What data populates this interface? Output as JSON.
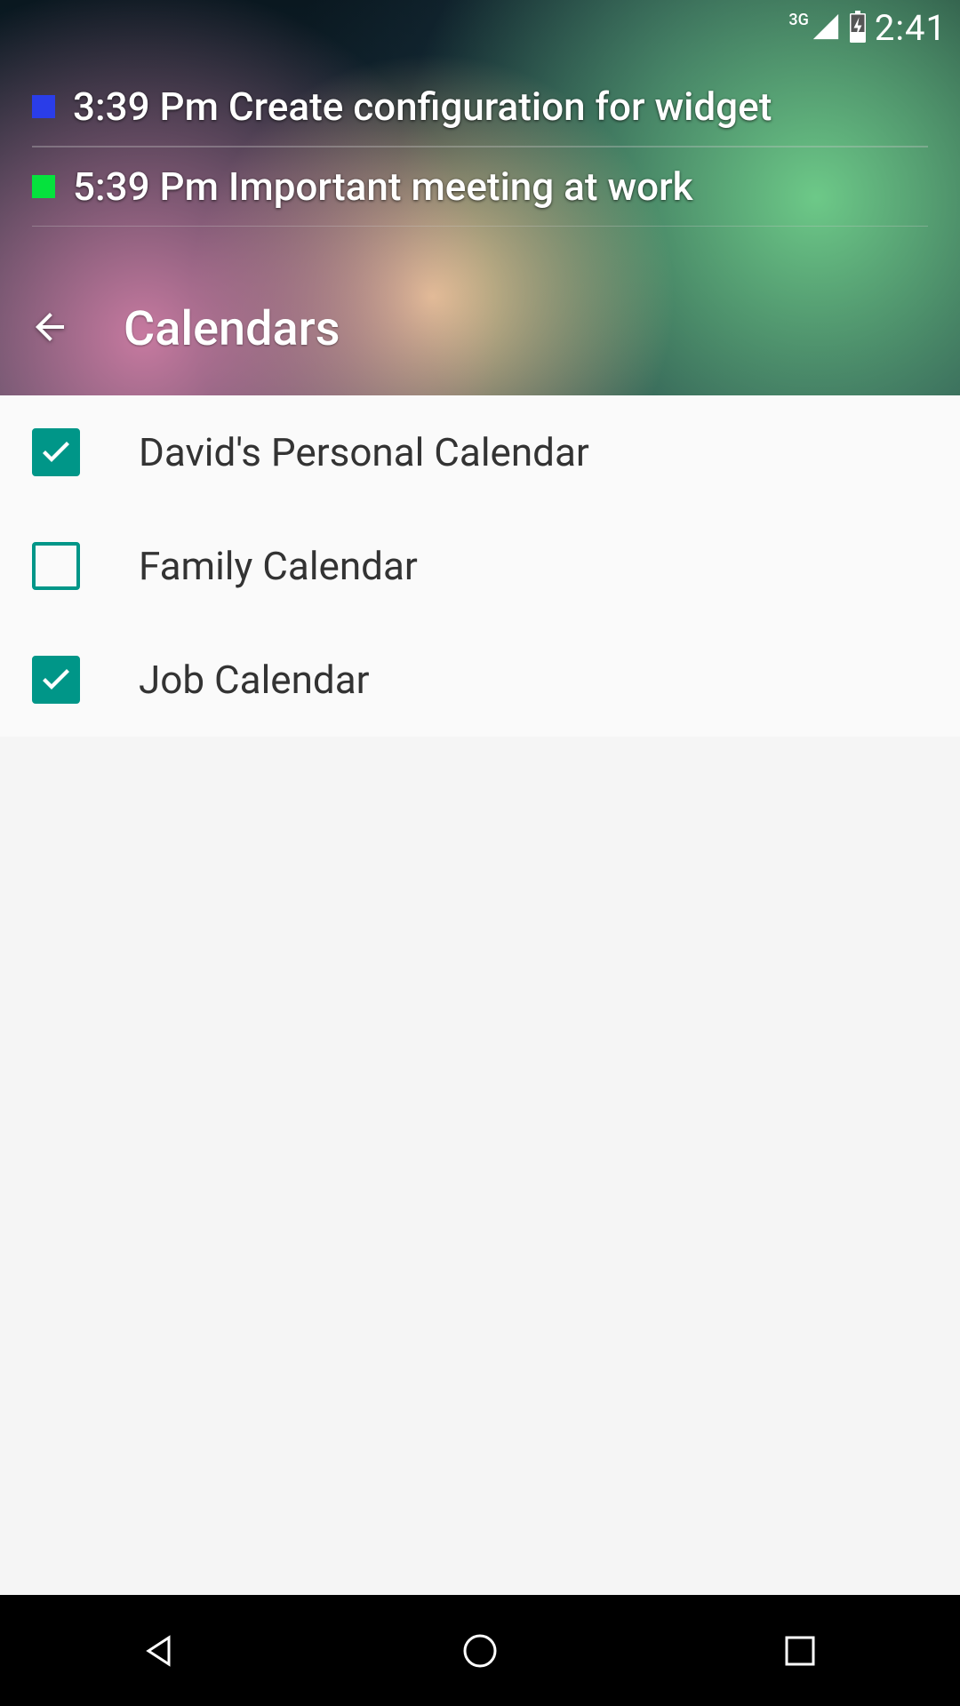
{
  "statusbar": {
    "network": "3G",
    "clock": "2:41"
  },
  "widget": {
    "events": [
      {
        "color": "#2a3de8",
        "text": "3:39 Pm Create configuration for widget"
      },
      {
        "color": "#05e23d",
        "text": "5:39 Pm Important meeting at work"
      }
    ]
  },
  "appbar": {
    "title": "Calendars"
  },
  "calendars": [
    {
      "label": "David's Personal Calendar",
      "checked": true
    },
    {
      "label": "Family Calendar",
      "checked": false
    },
    {
      "label": "Job Calendar",
      "checked": true
    }
  ],
  "colors": {
    "accent": "#009688"
  }
}
